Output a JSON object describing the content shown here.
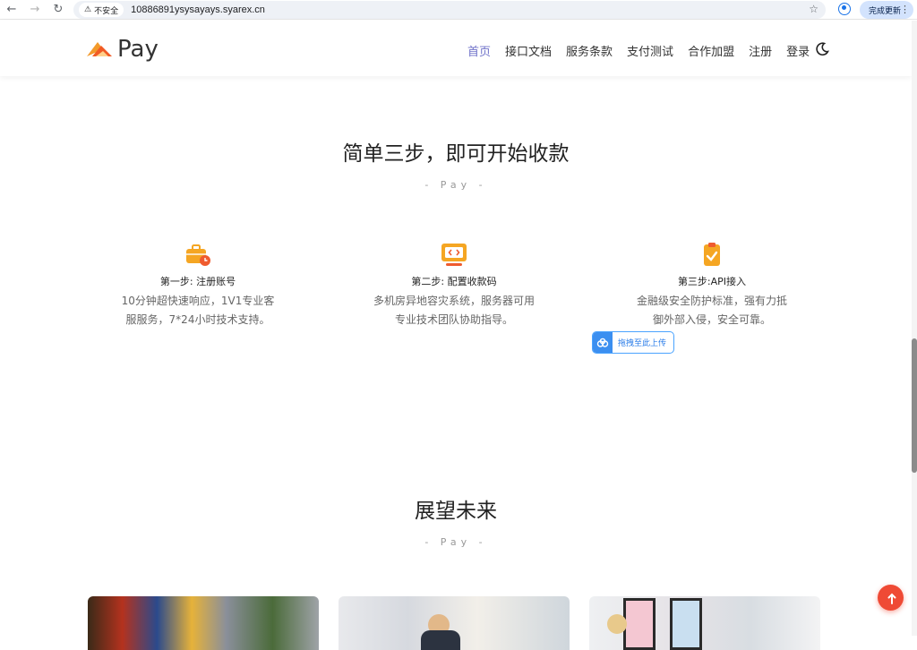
{
  "browser": {
    "security_label": "不安全",
    "url": "10886891ysysayays.syarex.cn",
    "update_label": "完成更新"
  },
  "site": {
    "logo_text": "Pay",
    "nav": [
      {
        "label": "首页",
        "active": true
      },
      {
        "label": "接口文档"
      },
      {
        "label": "服务条款"
      },
      {
        "label": "支付测试"
      },
      {
        "label": "合作加盟"
      },
      {
        "label": "注册"
      },
      {
        "label": "登录"
      }
    ]
  },
  "steps_section": {
    "title": "简单三步，即可开始收款",
    "subtitle": "- Pay -",
    "steps": [
      {
        "title": "第一步: 注册账号",
        "desc1": "10分钟超快速响应，1V1专业客",
        "desc2": "服服务，7*24小时技术支持。",
        "icon": "briefcase-clock-icon"
      },
      {
        "title": "第二步: 配置收款码",
        "desc1": "多机房异地容灾系统，服务器可用",
        "desc2": "专业技术团队协助指导。",
        "icon": "monitor-code-icon"
      },
      {
        "title": "第三步:API接入",
        "desc1": "金融级安全防护标准，强有力抵",
        "desc2": "御外部入侵，安全可靠。",
        "icon": "clipboard-check-icon"
      }
    ],
    "upload_label": "拖拽至此上传"
  },
  "future_section": {
    "title": "展望未来",
    "subtitle": "- Pay -"
  },
  "colors": {
    "accent": "#6f72c9",
    "orange": "#f39a2b",
    "fab": "#ef4a35"
  }
}
